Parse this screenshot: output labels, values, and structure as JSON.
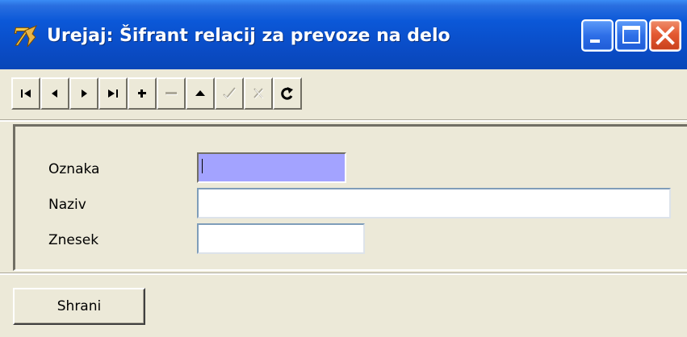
{
  "window": {
    "title": "Urejaj: Šifrant relacij za prevoze na delo",
    "icon": "app-7-icon",
    "controls": [
      "minimize-icon",
      "maximize-icon",
      "close-icon"
    ]
  },
  "toolbar": {
    "buttons": [
      {
        "name": "first-record",
        "icon": "first-icon",
        "enabled": true
      },
      {
        "name": "prior-record",
        "icon": "prior-icon",
        "enabled": true
      },
      {
        "name": "next-record",
        "icon": "next-icon",
        "enabled": true
      },
      {
        "name": "last-record",
        "icon": "last-icon",
        "enabled": true
      },
      {
        "name": "insert-record",
        "icon": "plus-icon",
        "enabled": true
      },
      {
        "name": "delete-record",
        "icon": "minus-icon",
        "enabled": false
      },
      {
        "name": "edit-record",
        "icon": "triangle-up-icon",
        "enabled": true
      },
      {
        "name": "post-record",
        "icon": "checkmark-icon",
        "enabled": false
      },
      {
        "name": "cancel-record",
        "icon": "x-icon",
        "enabled": false
      },
      {
        "name": "refresh-record",
        "icon": "refresh-icon",
        "enabled": true
      }
    ]
  },
  "form": {
    "oznaka_label": "Oznaka",
    "oznaka_value": "",
    "naziv_label": "Naziv",
    "naziv_value": "",
    "znesek_label": "Znesek",
    "znesek_value": ""
  },
  "actions": {
    "save_label": "Shrani"
  },
  "colors": {
    "titlebar": "#0A4CC6",
    "window_bg": "#ECE9D8",
    "focused_field": "#A3A3FF",
    "close_button": "#E45A32"
  }
}
